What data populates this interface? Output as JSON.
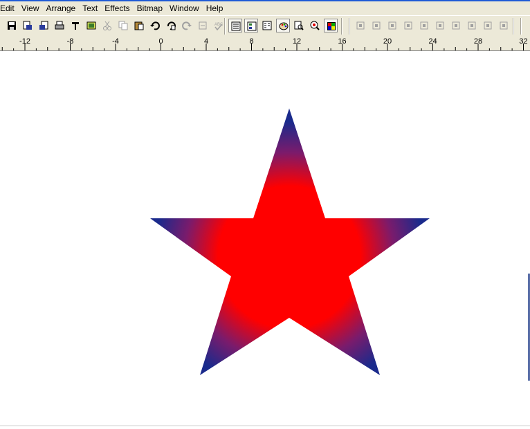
{
  "menu": [
    "Edit",
    "View",
    "Arrange",
    "Text",
    "Effects",
    "Bitmap",
    "Window",
    "Help"
  ],
  "ruler": {
    "labels": [
      "-12",
      "-8",
      "-4",
      "0",
      "4",
      "8",
      "12",
      "16",
      "20",
      "24",
      "28",
      "32"
    ]
  },
  "toolbar": {
    "buttons": [
      {
        "name": "save-icon",
        "enabled": true
      },
      {
        "name": "export-icon",
        "enabled": true
      },
      {
        "name": "import-icon",
        "enabled": true
      },
      {
        "name": "print-icon",
        "enabled": true
      },
      {
        "name": "print-setup-icon",
        "enabled": true
      },
      {
        "name": "print-preview-icon",
        "enabled": true
      },
      {
        "name": "cut-icon",
        "enabled": false
      },
      {
        "name": "copy-icon",
        "enabled": false
      },
      {
        "name": "paste-icon",
        "enabled": true
      },
      {
        "name": "undo-icon",
        "enabled": true
      },
      {
        "name": "undo-list-icon",
        "enabled": true
      },
      {
        "name": "redo-icon",
        "enabled": false
      },
      {
        "name": "repeat-icon",
        "enabled": false
      },
      {
        "name": "spell-check-icon",
        "enabled": false
      },
      {
        "name": "object-properties-icon",
        "enabled": true,
        "pressed": true
      },
      {
        "name": "object-manager-icon",
        "enabled": true,
        "pressed": true
      },
      {
        "name": "layers-icon",
        "enabled": true
      },
      {
        "name": "color-palette-icon",
        "enabled": true,
        "pressed": true
      },
      {
        "name": "zoom-page-icon",
        "enabled": true
      },
      {
        "name": "zoom-icon",
        "enabled": true
      },
      {
        "name": "color-styles-icon",
        "enabled": true,
        "pressed": true
      },
      {
        "name": "group-icon",
        "enabled": false
      },
      {
        "name": "ungroup-icon",
        "enabled": false
      },
      {
        "name": "combine-icon",
        "enabled": false
      },
      {
        "name": "to-front-icon",
        "enabled": false
      },
      {
        "name": "to-back-icon",
        "enabled": false
      },
      {
        "name": "break-apart-icon",
        "enabled": false
      },
      {
        "name": "weld-icon",
        "enabled": false
      },
      {
        "name": "trim-icon",
        "enabled": false
      },
      {
        "name": "intersect-icon",
        "enabled": false
      },
      {
        "name": "convert-curves-icon",
        "enabled": false
      }
    ]
  },
  "star": {
    "outer_color": "#1a2a8c",
    "middle_color": "#7a1b6c",
    "inner_color": "#ff0000"
  },
  "colors": {
    "ui_face": "#ece9d8",
    "title_accent": "#1f5bd6",
    "disabled_icon": "#a0a0a0"
  }
}
